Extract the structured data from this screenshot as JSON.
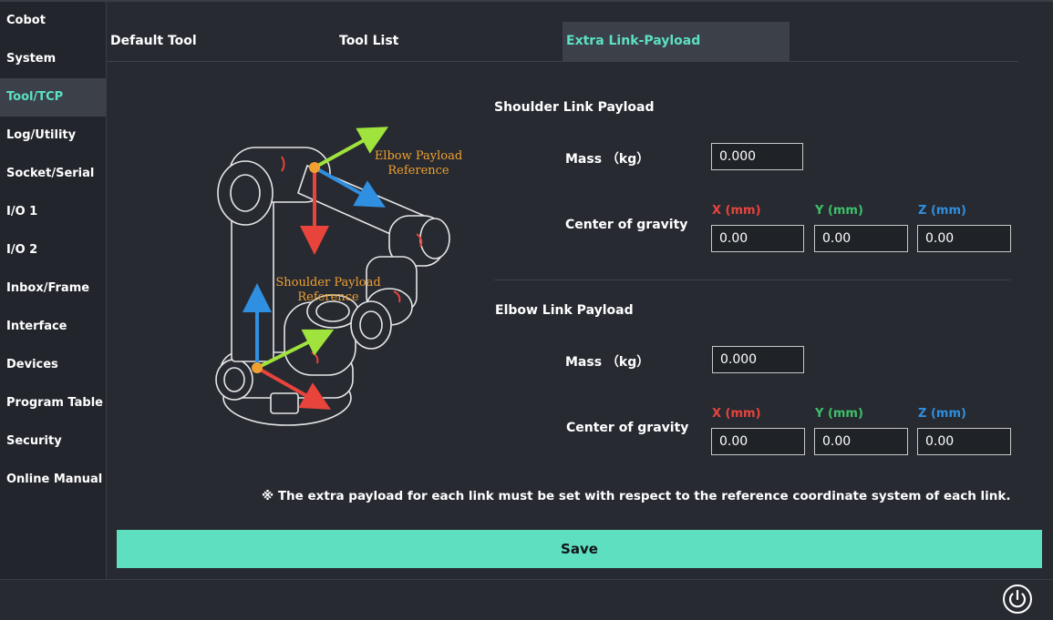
{
  "sidebar": {
    "items": [
      {
        "label": "Cobot"
      },
      {
        "label": "System"
      },
      {
        "label": "Tool/TCP",
        "active": true
      },
      {
        "label": "Log/Utility"
      },
      {
        "label": "Socket/Serial"
      },
      {
        "label": "I/O 1"
      },
      {
        "label": "I/O 2"
      },
      {
        "label": "Inbox/Frame"
      },
      {
        "label": "Interface"
      },
      {
        "label": "Devices"
      },
      {
        "label": "Program Table"
      },
      {
        "label": "Security"
      },
      {
        "label": "Online Manual"
      }
    ]
  },
  "tabs": [
    {
      "label": "Default Tool"
    },
    {
      "label": "Tool List"
    },
    {
      "label": "Extra Link-Payload",
      "active": true
    }
  ],
  "illustration": {
    "elbow_label_1": "Elbow Payload",
    "elbow_label_2": "Reference",
    "shoulder_label_1": "Shoulder Payload",
    "shoulder_label_2": "Reference"
  },
  "shoulder": {
    "title": "Shoulder Link Payload",
    "mass_label": "Mass （kg）",
    "mass_value": "0.000",
    "cog_label": "Center of gravity",
    "x_label": "X (mm)",
    "y_label": "Y (mm)",
    "z_label": "Z (mm)",
    "x_value": "0.00",
    "y_value": "0.00",
    "z_value": "0.00"
  },
  "elbow": {
    "title": "Elbow Link Payload",
    "mass_label": "Mass （kg）",
    "mass_value": "0.000",
    "cog_label": "Center of gravity",
    "x_label": "X (mm)",
    "y_label": "Y (mm)",
    "z_label": "Z (mm)",
    "x_value": "0.00",
    "y_value": "0.00",
    "z_value": "0.00"
  },
  "note": "※ The extra payload for each link must be set with respect to the reference coordinate system of each link.",
  "save_label": "Save",
  "colors": {
    "accent": "#5ce1c1",
    "x_axis": "#e8443c",
    "y_axis": "#3fc06a",
    "z_axis": "#2f8fe0",
    "reference_label": "#f0a030"
  },
  "icons": {
    "power": "power-icon"
  }
}
